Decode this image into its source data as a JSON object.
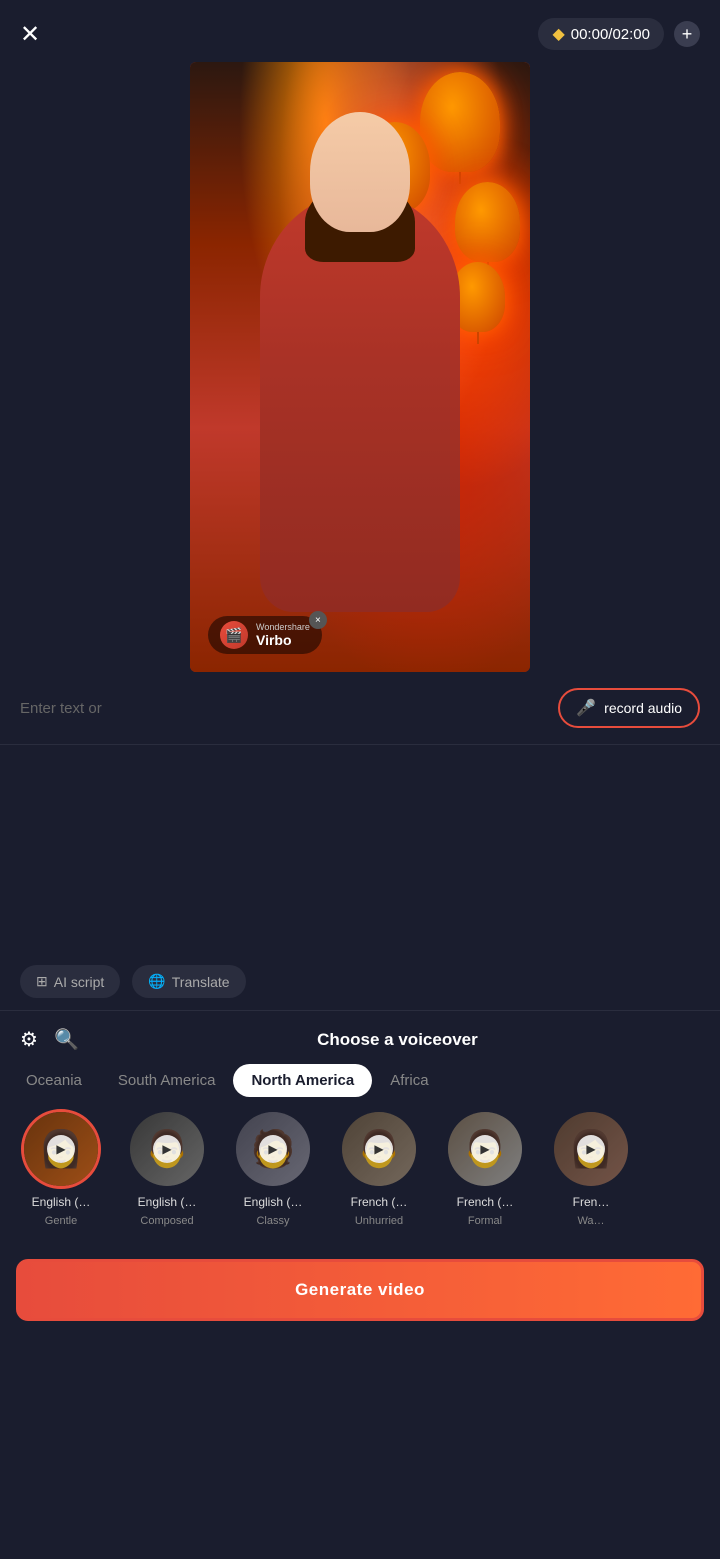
{
  "header": {
    "close_label": "✕",
    "timer": "00:00/02:00",
    "plus_label": "+"
  },
  "video": {
    "watermark_brand": "Wondershare",
    "watermark_name": "Virbo",
    "watermark_close": "×"
  },
  "text_input": {
    "placeholder": "Enter text or",
    "record_audio_label": "record audio"
  },
  "toolbar": {
    "ai_script_label": "AI script",
    "translate_label": "Translate"
  },
  "voiceover": {
    "title": "Choose a voiceover",
    "filter_icon": "≡",
    "search_icon": "⌕"
  },
  "regions": [
    {
      "id": "oceania",
      "label": "Oceania",
      "active": false
    },
    {
      "id": "south-america",
      "label": "South America",
      "active": false
    },
    {
      "id": "north-america",
      "label": "North America",
      "active": true
    },
    {
      "id": "africa",
      "label": "Africa",
      "active": false
    }
  ],
  "voices": [
    {
      "id": 1,
      "name": "English (…",
      "style": "Gentle",
      "selected": true,
      "av_class": "av1"
    },
    {
      "id": 2,
      "name": "English (…",
      "style": "Composed",
      "selected": false,
      "av_class": "av2"
    },
    {
      "id": 3,
      "name": "English (…",
      "style": "Classy",
      "selected": false,
      "av_class": "av3"
    },
    {
      "id": 4,
      "name": "French (…",
      "style": "Unhurried",
      "selected": false,
      "av_class": "av4"
    },
    {
      "id": 5,
      "name": "French (…",
      "style": "Formal",
      "selected": false,
      "av_class": "av5"
    },
    {
      "id": 6,
      "name": "Fren…",
      "style": "Wa…",
      "selected": false,
      "av_class": "av6"
    }
  ],
  "generate": {
    "button_label": "Generate video"
  }
}
